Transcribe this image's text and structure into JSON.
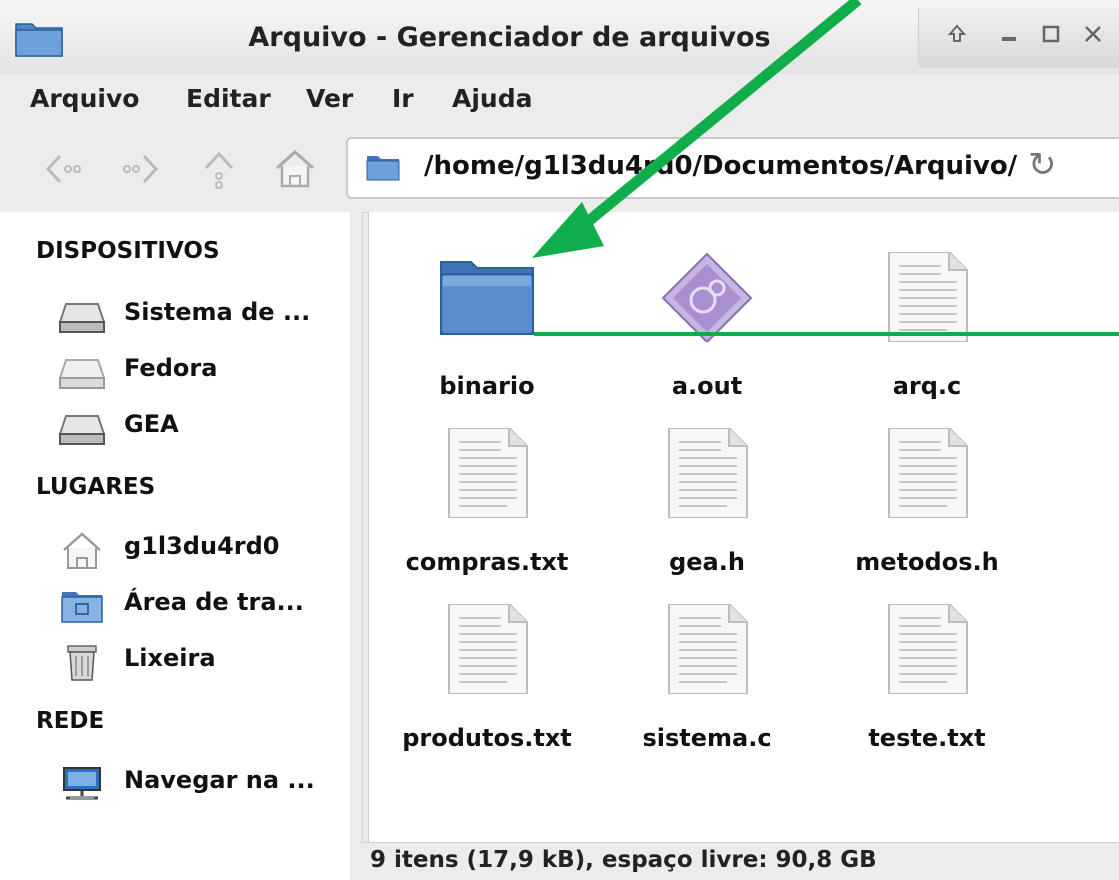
{
  "window": {
    "title": "Arquivo - Gerenciador de arquivos"
  },
  "menu": {
    "items": [
      "Arquivo",
      "Editar",
      "Ver",
      "Ir",
      "Ajuda"
    ]
  },
  "toolbar": {
    "back_icon": "back-arrow-icon",
    "forward_icon": "forward-arrow-icon",
    "up_icon": "up-arrow-icon",
    "home_icon": "home-icon",
    "address": "/home/g1l3du4rd0/Documentos/Arquivo/",
    "reload_icon": "reload-icon"
  },
  "sidebar": {
    "sections": [
      {
        "header": "DISPOSITIVOS",
        "items": [
          {
            "label": "Sistema de ...",
            "icon": "drive-icon"
          },
          {
            "label": "Fedora",
            "icon": "drive-icon"
          },
          {
            "label": "GEA",
            "icon": "drive-icon"
          }
        ]
      },
      {
        "header": "LUGARES",
        "items": [
          {
            "label": "g1l3du4rd0",
            "icon": "home-icon"
          },
          {
            "label": "Área de tra...",
            "icon": "desktop-folder-icon"
          },
          {
            "label": "Lixeira",
            "icon": "trash-icon"
          }
        ]
      },
      {
        "header": "REDE",
        "items": [
          {
            "label": "Navegar na ...",
            "icon": "network-icon"
          }
        ]
      }
    ]
  },
  "files": [
    {
      "name": "binario",
      "type": "folder"
    },
    {
      "name": "a.out",
      "type": "executable"
    },
    {
      "name": "arq.c",
      "type": "text"
    },
    {
      "name": "compras.txt",
      "type": "text"
    },
    {
      "name": "gea.h",
      "type": "text"
    },
    {
      "name": "metodos.h",
      "type": "text"
    },
    {
      "name": "produtos.txt",
      "type": "text"
    },
    {
      "name": "sistema.c",
      "type": "text"
    },
    {
      "name": "teste.txt",
      "type": "text"
    }
  ],
  "status": {
    "text": "9 itens (17,9 kB), espaço livre: 90,8 GB"
  },
  "colors": {
    "annotation": "#0fae4a",
    "folder": "#5b8ccb"
  }
}
